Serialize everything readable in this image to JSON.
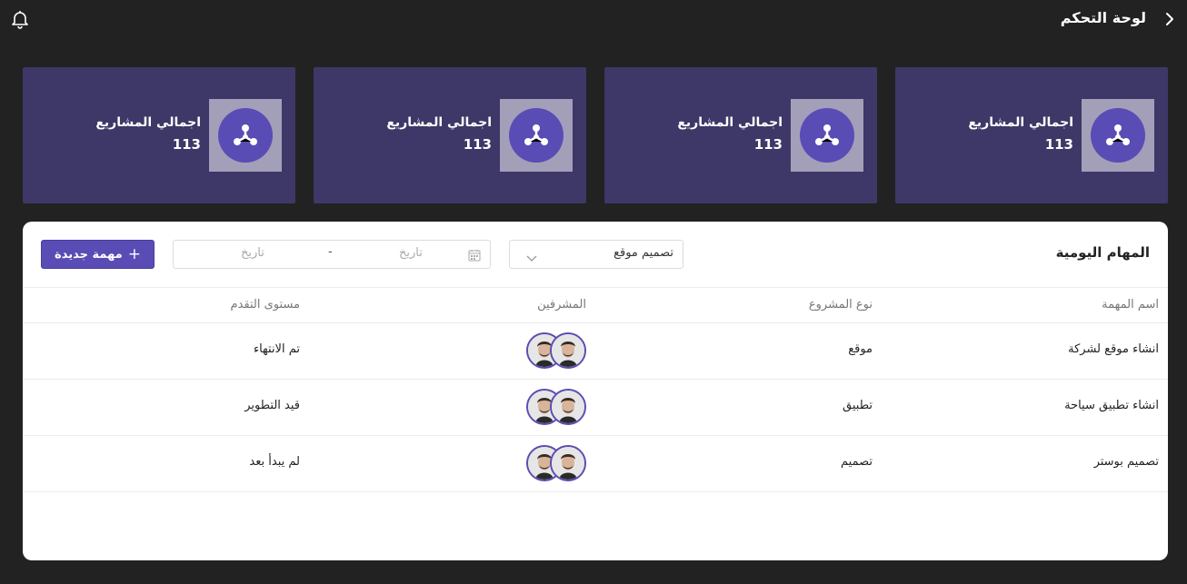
{
  "header": {
    "title": "لوحة التحكم"
  },
  "cards": [
    {
      "title": "اجمالي المشاريع",
      "value": "113"
    },
    {
      "title": "اجمالي المشاريع",
      "value": "113"
    },
    {
      "title": "اجمالي المشاريع",
      "value": "113"
    },
    {
      "title": "اجمالي المشاريع",
      "value": "113"
    }
  ],
  "tasks": {
    "title": "المهام اليومية",
    "filter_select": {
      "value": "تصميم موقع"
    },
    "date_range": {
      "start_placeholder": "تاريخ",
      "separator": "-",
      "end_placeholder": "تاريخ"
    },
    "new_button_label": "مهمة جديدة",
    "columns": {
      "name": "اسم المهمة",
      "type": "نوع المشروع",
      "supervisors": "المشرفين",
      "progress": "مستوى التقدم"
    },
    "rows": [
      {
        "name": "انشاء موقع لشركة",
        "type": "موقع",
        "progress": "تم الانتهاء"
      },
      {
        "name": "انشاء تطبيق سياحة",
        "type": "تطبيق",
        "progress": "قيد التطوير"
      },
      {
        "name": "تصميم بوستر",
        "type": "تصميم",
        "progress": "لم يبدأ بعد"
      }
    ]
  },
  "colors": {
    "background": "#222222",
    "card": "#3d3867",
    "accent": "#5a4cb5"
  }
}
